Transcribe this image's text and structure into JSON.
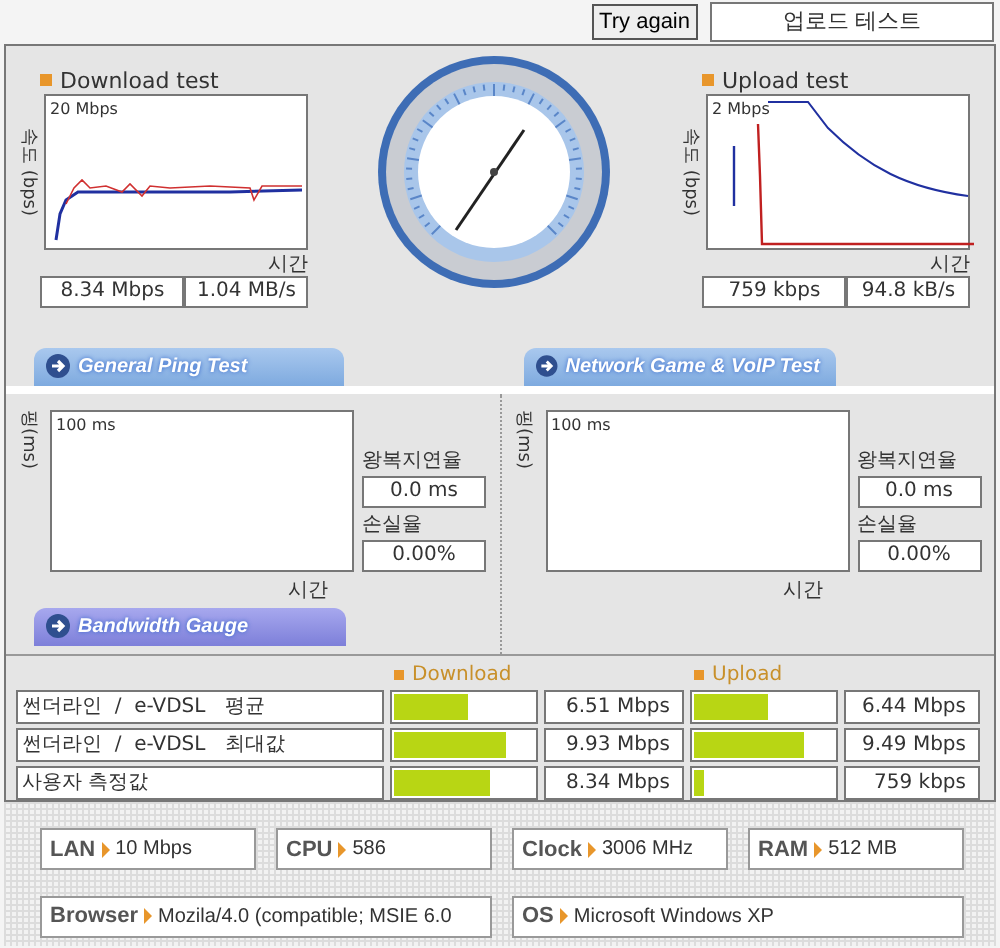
{
  "header": {
    "button": "Try again",
    "title": "업로드 테스트"
  },
  "tests": [
    {
      "kind": "download",
      "title": "Download test",
      "y_axis": "속도 (bps)",
      "max_label": "20 Mbps",
      "x_axis": "시간",
      "rate": "8.34 Mbps",
      "bytes": "1.04 MB/s"
    },
    {
      "kind": "upload",
      "title": "Upload test",
      "y_axis": "속도 (bps)",
      "max_label": "2 Mbps",
      "x_axis": "시간",
      "rate": "759 kbps",
      "bytes": "94.8 kB/s"
    }
  ],
  "ping_tabs": [
    {
      "label": "General Ping Test"
    },
    {
      "label": "Network Game & VoIP Test"
    }
  ],
  "ping_panels": [
    {
      "y_axis": "핑(ms)",
      "max_label": "100 ms",
      "x_axis": "시간",
      "latency_label": "왕복지연율",
      "latency": "0.0 ms",
      "loss_label": "손실율",
      "loss": "0.00%"
    },
    {
      "y_axis": "핑(ms)",
      "max_label": "100 ms",
      "x_axis": "시간",
      "latency_label": "왕복지연율",
      "latency": "0.0 ms",
      "loss_label": "손실율",
      "loss": "0.00%"
    }
  ],
  "bandwidth": {
    "title": "Bandwidth Gauge",
    "columns": [
      "Download",
      "Upload"
    ],
    "rows": [
      {
        "label": "썬더라인  /  e-VDSL   평균",
        "download": {
          "level": 0.53,
          "value": "6.51 Mbps"
        },
        "upload": {
          "level": 0.53,
          "value": "6.44 Mbps"
        }
      },
      {
        "label": "썬더라인  /  e-VDSL   최대값",
        "download": {
          "level": 0.8,
          "value": "9.93 Mbps"
        },
        "upload": {
          "level": 0.78,
          "value": "9.49 Mbps"
        }
      },
      {
        "label": "사용자 측정값",
        "download": {
          "level": 0.68,
          "value": "8.34 Mbps"
        },
        "upload": {
          "level": 0.07,
          "value": "759 kbps"
        }
      }
    ]
  },
  "system": [
    {
      "label": "LAN",
      "value": "10 Mbps"
    },
    {
      "label": "CPU",
      "value": "586"
    },
    {
      "label": "Clock",
      "value": "3006 MHz"
    },
    {
      "label": "RAM",
      "value": "512 MB"
    },
    {
      "label": "Browser",
      "value": "Mozila/4.0 (compatible; MSIE 6.0"
    },
    {
      "label": "OS",
      "value": "Microsoft Windows XP"
    }
  ]
}
